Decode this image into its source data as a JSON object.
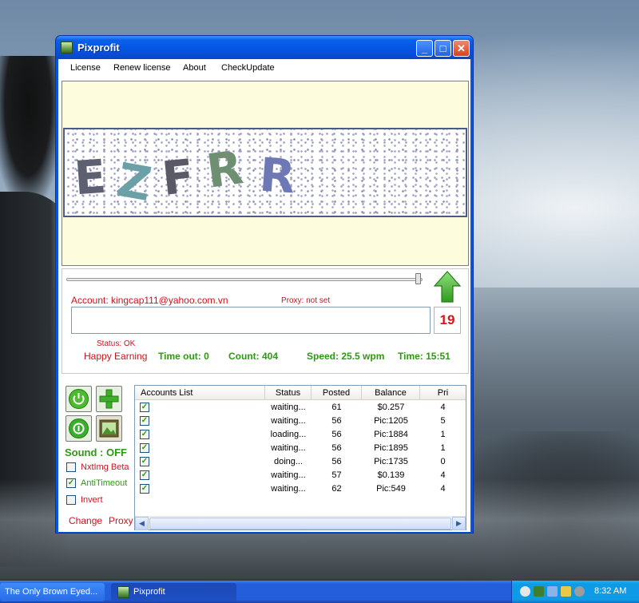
{
  "window": {
    "title": "Pixprofit",
    "minimize_glyph": "_",
    "maximize_glyph": "□",
    "close_glyph": "✕"
  },
  "menu": [
    "License",
    "Renew license",
    "About",
    "CheckUpdate"
  ],
  "captcha": {
    "characters": [
      "E",
      "Z",
      "F",
      "R",
      "R"
    ]
  },
  "panel": {
    "slider_level": 0.99,
    "account_label": "Account: ",
    "account_value": "kingcap111@yahoo.com.vn",
    "proxy_text": "Proxy: not set",
    "answer_value": "",
    "counter": "19",
    "status_text": "Status: OK",
    "happy_text": "Happy Earning",
    "timeout_text": "Time out: 0",
    "count_text": "Count: 404",
    "speed_text": "Speed: 25.5 wpm",
    "time_text": "Time: 15:51"
  },
  "controls": {
    "sound_label": "Sound : OFF",
    "checkboxes": [
      {
        "label": "NxtImg Beta",
        "checked": false
      },
      {
        "label": "AntiTimeout",
        "checked": true
      },
      {
        "label": "Invert",
        "checked": false
      }
    ],
    "change_label": "Change",
    "proxy_label": "Proxy",
    "check_glyph": "✓"
  },
  "accounts": {
    "columns": [
      "Accounts List",
      "Status",
      "Posted",
      "Balance",
      "Pri"
    ],
    "rows": [
      {
        "checked": true,
        "status": "waiting...",
        "posted": "61",
        "balance": "$0.257",
        "pri": "4"
      },
      {
        "checked": true,
        "status": "waiting...",
        "posted": "56",
        "balance": "Pic:1205",
        "pri": "5"
      },
      {
        "checked": true,
        "status": "loading...",
        "posted": "56",
        "balance": "Pic:1884",
        "pri": "1"
      },
      {
        "checked": true,
        "status": "waiting...",
        "posted": "56",
        "balance": "Pic:1895",
        "pri": "1"
      },
      {
        "checked": true,
        "status": "doing...",
        "posted": "56",
        "balance": "Pic:1735",
        "pri": "0"
      },
      {
        "checked": true,
        "status": "waiting...",
        "posted": "57",
        "balance": "$0.139",
        "pri": "4"
      },
      {
        "checked": true,
        "status": "waiting...",
        "posted": "62",
        "balance": "Pic:549",
        "pri": "4"
      }
    ]
  },
  "taskbar": {
    "items": [
      "The Only Brown Eyed...",
      "Pixprofit"
    ],
    "clock": "8:32 AM"
  },
  "colors": {
    "accent_red": "#c8161e",
    "accent_green": "#2d9a12",
    "titlebar_blue": "#0554e3"
  }
}
